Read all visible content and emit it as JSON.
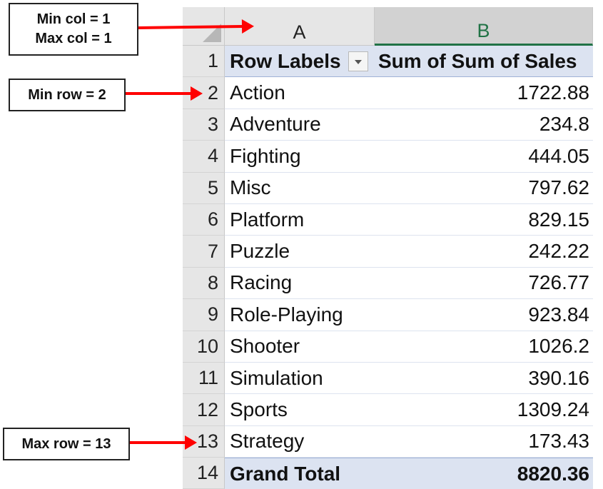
{
  "columns": [
    "A",
    "B"
  ],
  "pivot": {
    "header": {
      "row": "1",
      "label": "Row Labels",
      "value_label": "Sum of Sum of Sales"
    },
    "rows": [
      {
        "row": "2",
        "label": "Action",
        "value": "1722.88"
      },
      {
        "row": "3",
        "label": "Adventure",
        "value": "234.8"
      },
      {
        "row": "4",
        "label": "Fighting",
        "value": "444.05"
      },
      {
        "row": "5",
        "label": "Misc",
        "value": "797.62"
      },
      {
        "row": "6",
        "label": "Platform",
        "value": "829.15"
      },
      {
        "row": "7",
        "label": "Puzzle",
        "value": "242.22"
      },
      {
        "row": "8",
        "label": "Racing",
        "value": "726.77"
      },
      {
        "row": "9",
        "label": "Role-Playing",
        "value": "923.84"
      },
      {
        "row": "10",
        "label": "Shooter",
        "value": "1026.2"
      },
      {
        "row": "11",
        "label": "Simulation",
        "value": "390.16"
      },
      {
        "row": "12",
        "label": "Sports",
        "value": "1309.24"
      },
      {
        "row": "13",
        "label": "Strategy",
        "value": "173.43"
      }
    ],
    "total": {
      "row": "14",
      "label": "Grand Total",
      "value": "8820.36"
    }
  },
  "callouts": {
    "min_col": "Min col = 1",
    "max_col": "Max col = 1",
    "min_row": "Min row = 2",
    "max_row": "Max row = 13"
  },
  "colors": {
    "arrow": "#ff0000",
    "pivot_header": "#dce3f1",
    "selected_column_accent": "#217346"
  }
}
